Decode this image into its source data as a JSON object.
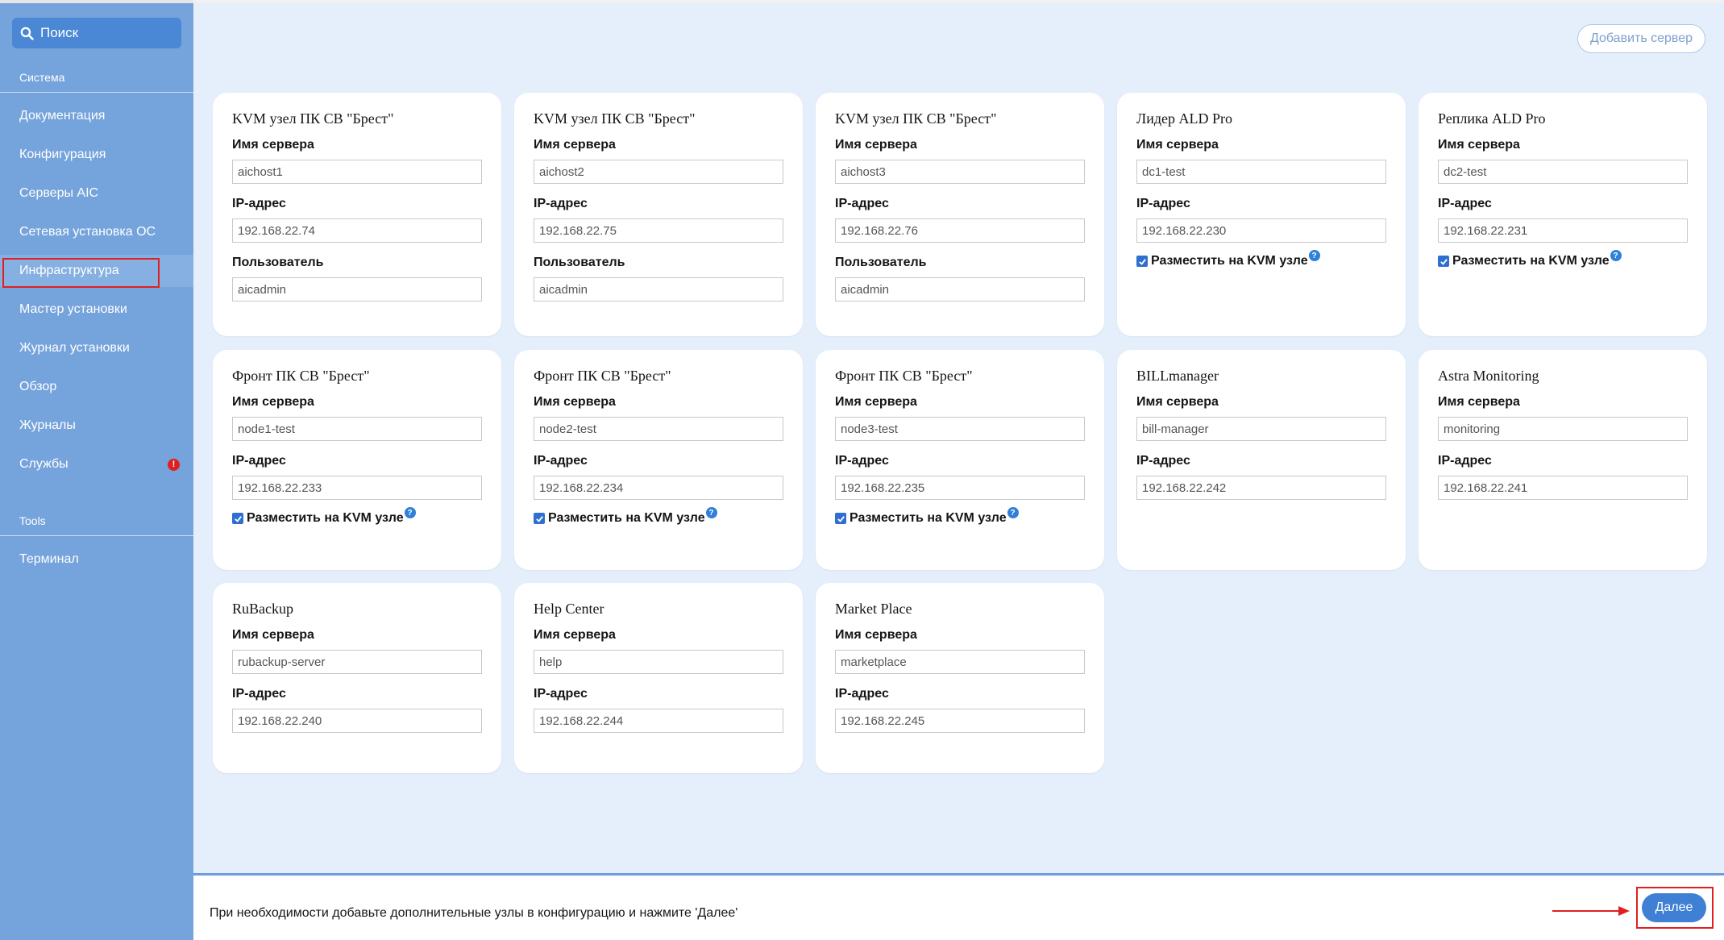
{
  "sidebar": {
    "search_label": "Поиск",
    "section_system": "Система",
    "items": [
      {
        "label": "Документация"
      },
      {
        "label": "Конфигурация"
      },
      {
        "label": "Серверы AIC"
      },
      {
        "label": "Сетевая установка ОС"
      },
      {
        "label": "Инфраструктура"
      },
      {
        "label": "Мастер установки"
      },
      {
        "label": "Журнал установки"
      },
      {
        "label": "Обзор"
      },
      {
        "label": "Журналы"
      },
      {
        "label": "Службы",
        "badge": "!"
      }
    ],
    "section_tools": "Tools",
    "tools_items": [
      {
        "label": "Терминал"
      }
    ]
  },
  "toolbar": {
    "add_server_label": "Добавить сервер"
  },
  "labels": {
    "server_name": "Имя сервера",
    "ip": "IP-адрес",
    "user": "Пользователь",
    "kvm": "Разместить на KVM узле",
    "help": "?"
  },
  "cards": [
    {
      "title": "KVM узел ПК СВ \"Брест\"",
      "server_name": "aichost1",
      "ip": "192.168.22.74",
      "user": "aicadmin"
    },
    {
      "title": "KVM узел ПК СВ \"Брест\"",
      "server_name": "aichost2",
      "ip": "192.168.22.75",
      "user": "aicadmin"
    },
    {
      "title": "KVM узел ПК СВ \"Брест\"",
      "server_name": "aichost3",
      "ip": "192.168.22.76",
      "user": "aicadmin"
    },
    {
      "title": "Лидер ALD Pro",
      "server_name": "dc1-test",
      "ip": "192.168.22.230"
    },
    {
      "title": "Реплика ALD Pro",
      "server_name": "dc2-test",
      "ip": "192.168.22.231"
    },
    {
      "title": "Фронт ПК СВ \"Брест\"",
      "server_name": "node1-test",
      "ip": "192.168.22.233"
    },
    {
      "title": "Фронт ПК СВ \"Брест\"",
      "server_name": "node2-test",
      "ip": "192.168.22.234"
    },
    {
      "title": "Фронт ПК СВ \"Брест\"",
      "server_name": "node3-test",
      "ip": "192.168.22.235"
    },
    {
      "title": "BILLmanager",
      "server_name": "bill-manager",
      "ip": "192.168.22.242"
    },
    {
      "title": "Astra Monitoring",
      "server_name": "monitoring",
      "ip": "192.168.22.241"
    },
    {
      "title": "RuBackup",
      "server_name": "rubackup-server",
      "ip": "192.168.22.240"
    },
    {
      "title": "Help Center",
      "server_name": "help",
      "ip": "192.168.22.244"
    },
    {
      "title": "Market Place",
      "server_name": "marketplace",
      "ip": "192.168.22.245"
    }
  ],
  "footer": {
    "message": "При необходимости добавьте дополнительные узлы в конфигурацию и нажмите 'Далее'",
    "next_label": "Далее"
  },
  "colors": {
    "sidebar_bg": "#75a3db",
    "accent": "#3f7fd4",
    "highlight": "#e02020"
  }
}
